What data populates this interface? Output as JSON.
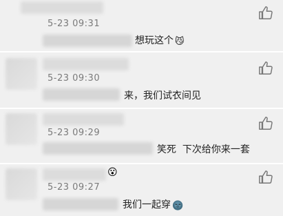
{
  "comments": [
    {
      "timestamp": "5-23 09:31",
      "text": "想玩这个",
      "emoji": "😼"
    },
    {
      "timestamp": "5-23 09:30",
      "text": "来，我们试衣间见",
      "emoji": ""
    },
    {
      "timestamp": "5-23 09:29",
      "text": "笑死  下次给你来一套",
      "emoji": ""
    },
    {
      "timestamp": "5-23 09:27",
      "text": "我们一起穿",
      "emoji": "🌚",
      "badge": "😮"
    }
  ],
  "icons": {
    "like": "thumbs-up-icon"
  }
}
